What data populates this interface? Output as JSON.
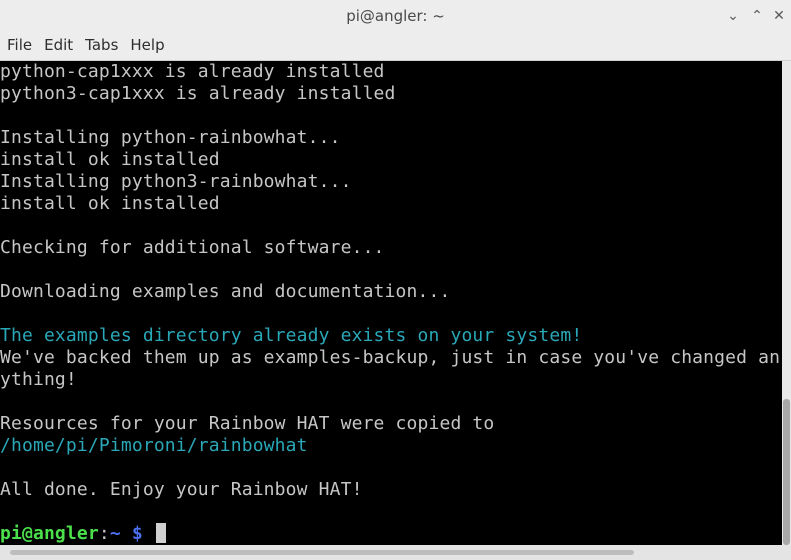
{
  "window": {
    "title": "pi@angler: ~",
    "minimize_glyph": "⌄",
    "maximize_glyph": "⌃",
    "close_glyph": "✕"
  },
  "menu": [
    "File",
    "Edit",
    "Tabs",
    "Help"
  ],
  "terminal": {
    "lines": [
      {
        "text": "python-cap1xxx is already installed",
        "style": "normal"
      },
      {
        "text": "python3-cap1xxx is already installed",
        "style": "normal"
      },
      {
        "text": "",
        "style": "normal"
      },
      {
        "text": "Installing python-rainbowhat...",
        "style": "normal"
      },
      {
        "text": "install ok installed",
        "style": "normal"
      },
      {
        "text": "Installing python3-rainbowhat...",
        "style": "normal"
      },
      {
        "text": "install ok installed",
        "style": "normal"
      },
      {
        "text": "",
        "style": "normal"
      },
      {
        "text": "Checking for additional software...",
        "style": "normal"
      },
      {
        "text": "",
        "style": "normal"
      },
      {
        "text": "Downloading examples and documentation...",
        "style": "normal"
      },
      {
        "text": "",
        "style": "normal"
      },
      {
        "text": "The examples directory already exists on your system!",
        "style": "cyan"
      },
      {
        "text": "We've backed them up as examples-backup, just in case you've changed an",
        "style": "normal"
      },
      {
        "text": "ything!",
        "style": "normal"
      },
      {
        "text": "",
        "style": "normal"
      },
      {
        "text": "Resources for your Rainbow HAT were copied to",
        "style": "normal"
      },
      {
        "text": "/home/pi/Pimoroni/rainbowhat",
        "style": "cyan"
      },
      {
        "text": "",
        "style": "normal"
      },
      {
        "text": "All done. Enjoy your Rainbow HAT!",
        "style": "normal"
      },
      {
        "text": "",
        "style": "normal"
      }
    ],
    "prompt": {
      "user_host": "pi@angler",
      "colon": ":",
      "path": "~ $",
      "trailing": " "
    }
  },
  "colors": {
    "background": "#000000",
    "text": "#c6c6c6",
    "cyan": "#2aa8b8",
    "prompt_user": "#4be04b",
    "prompt_path": "#4a6ff0"
  }
}
